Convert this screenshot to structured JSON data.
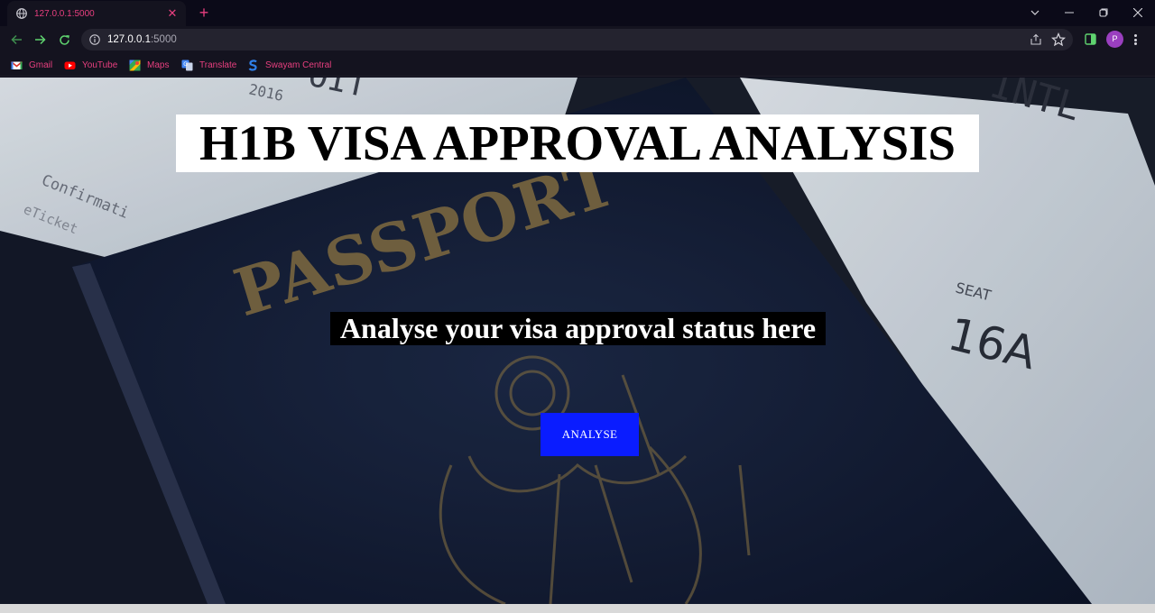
{
  "browser": {
    "tab": {
      "title": "127.0.0.1:5000",
      "favicon": "globe-icon"
    },
    "address": {
      "host": "127.0.0.1",
      "port": ":5000"
    },
    "profile_initial": "P",
    "bookmarks": [
      {
        "label": "Gmail",
        "icon": "gmail-icon"
      },
      {
        "label": "YouTube",
        "icon": "youtube-icon"
      },
      {
        "label": "Maps",
        "icon": "maps-icon"
      },
      {
        "label": "Translate",
        "icon": "translate-icon"
      },
      {
        "label": "Swayam Central",
        "icon": "swayam-icon"
      }
    ],
    "accent_color": "#e83f7f"
  },
  "page": {
    "title": "H1B VISA APPROVAL ANALYSIS",
    "subtitle": "Analyse your visa approval status here",
    "button_label": "ANALYSE",
    "background_image": "passport-background",
    "button_color": "#0a1cff"
  }
}
